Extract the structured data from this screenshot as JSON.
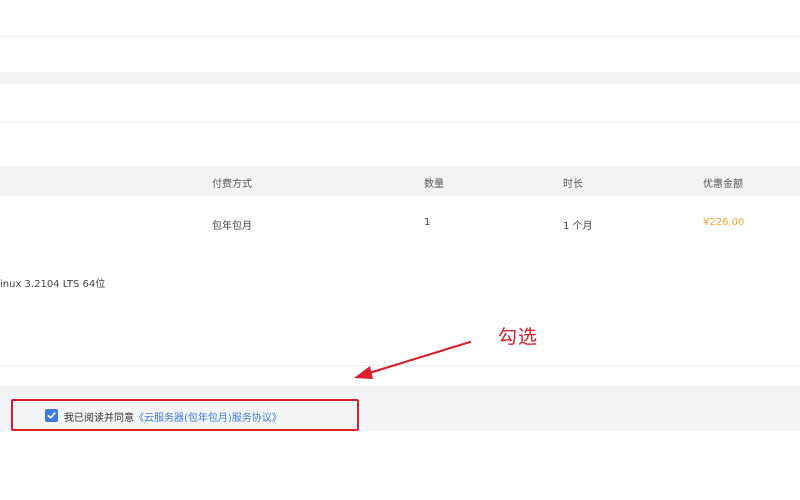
{
  "table": {
    "headers": [
      "付费方式",
      "数量",
      "时长",
      "优惠金额"
    ],
    "row": {
      "payment": "包年包月",
      "quantity": "1",
      "duration": "1 个月",
      "discount": "¥226.00"
    }
  },
  "os_info": "inux 3.2104 LTS 64位",
  "agreement": {
    "checked": true,
    "prefix": "我已阅读并同意",
    "link": "《云服务器(包年包月)服务协议》"
  },
  "annotation": {
    "text": "勾选"
  },
  "colors": {
    "accent": "#3f7ae0",
    "highlight": "#d9202a",
    "price": "#f5a03a"
  }
}
